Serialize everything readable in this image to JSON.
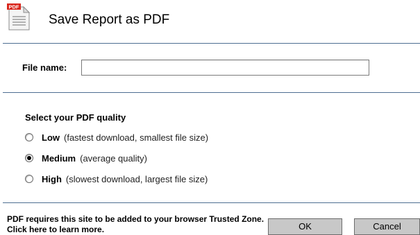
{
  "dialog": {
    "title": "Save Report as PDF",
    "icon": "pdf-document-icon",
    "icon_badge": "PDF"
  },
  "filename": {
    "label": "File name:",
    "value": "",
    "placeholder": ""
  },
  "quality": {
    "heading": "Select your PDF quality",
    "options": [
      {
        "name": "Low",
        "description": "(fastest download, smallest file size)",
        "selected": false
      },
      {
        "name": "Medium",
        "description": "(average quality)",
        "selected": true
      },
      {
        "name": "High",
        "description": "(slowest download, largest file size)",
        "selected": false
      }
    ]
  },
  "footer": {
    "notice": "PDF requires this site to be added to your browser Trusted Zone. Click here to learn more.",
    "ok_label": "OK",
    "cancel_label": "Cancel"
  },
  "colors": {
    "divider": "#4d6e91",
    "button_bg": "#c8c8c8",
    "icon_red": "#d9261c"
  }
}
